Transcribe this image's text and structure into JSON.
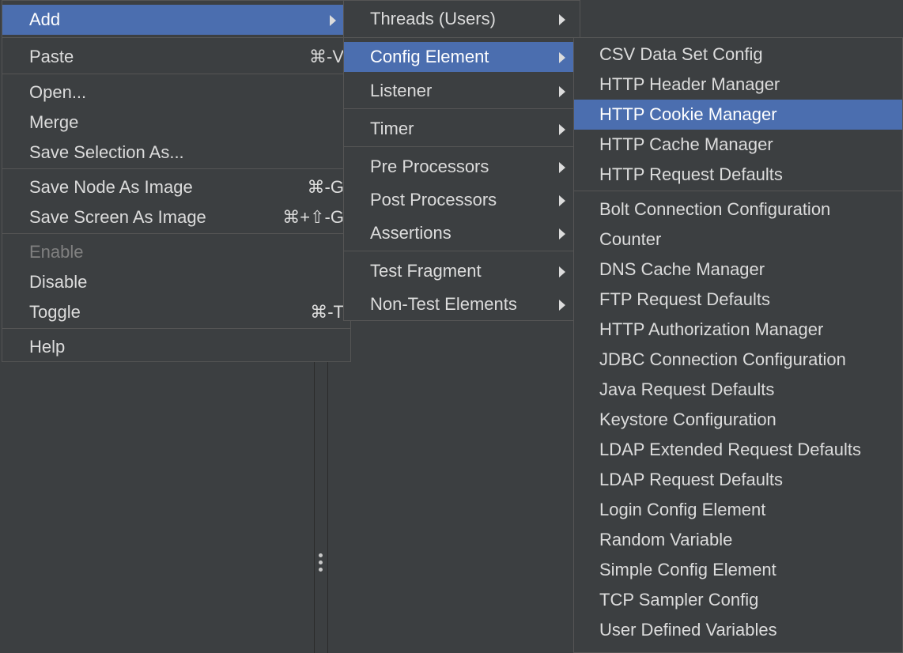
{
  "context_menu": {
    "add": "Add",
    "paste": "Paste",
    "paste_shortcut": "⌘-V",
    "open": "Open...",
    "merge": "Merge",
    "save_selection_as": "Save Selection As...",
    "save_node_as_image": "Save Node As Image",
    "save_node_shortcut": "⌘-G",
    "save_screen_as_image": "Save Screen As Image",
    "save_screen_shortcut": "⌘+⇧-G",
    "enable": "Enable",
    "disable": "Disable",
    "toggle": "Toggle",
    "toggle_shortcut": "⌘-T",
    "help": "Help"
  },
  "add_submenu": {
    "threads": "Threads (Users)",
    "config_element": "Config Element",
    "listener": "Listener",
    "timer": "Timer",
    "pre_processors": "Pre Processors",
    "post_processors": "Post Processors",
    "assertions": "Assertions",
    "test_fragment": "Test Fragment",
    "non_test_elements": "Non-Test Elements"
  },
  "config_submenu": {
    "items": [
      "CSV Data Set Config",
      "HTTP Header Manager",
      "HTTP Cookie Manager",
      "HTTP Cache Manager",
      "HTTP Request Defaults",
      "Bolt Connection Configuration",
      "Counter",
      "DNS Cache Manager",
      "FTP Request Defaults",
      "HTTP Authorization Manager",
      "JDBC Connection Configuration",
      "Java Request Defaults",
      "Keystore Configuration",
      "LDAP Extended Request Defaults",
      "LDAP Request Defaults",
      "Login Config Element",
      "Random Variable",
      "Simple Config Element",
      "TCP Sampler Config",
      "User Defined Variables"
    ],
    "selected": "HTTP Cookie Manager"
  },
  "colors": {
    "menu_background": "#3c3f41",
    "selection": "#4b6eaf",
    "separator": "#555555",
    "disabled_text": "#808080"
  }
}
